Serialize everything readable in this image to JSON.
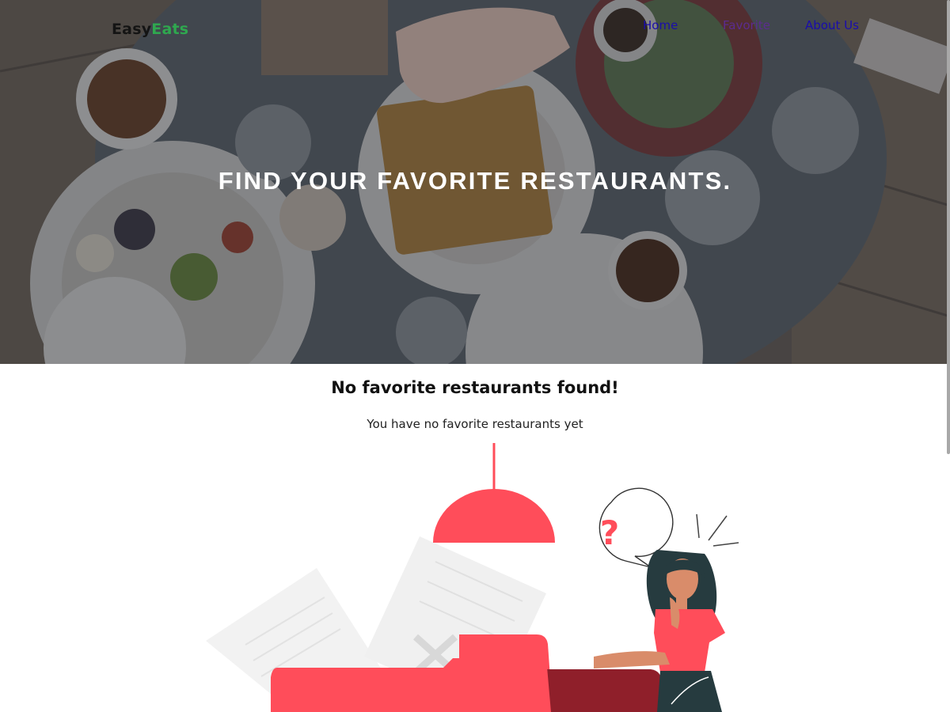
{
  "navbar": {
    "brand_part1": "Easy",
    "brand_part2": "Eats",
    "links": [
      {
        "label": "Home"
      },
      {
        "label": "Favorite"
      },
      {
        "label": "About Us"
      }
    ]
  },
  "hero": {
    "title": "FIND YOUR FAVORITE RESTAURANTS."
  },
  "empty_state": {
    "title": "No favorite restaurants found!",
    "subtitle": "You have no favorite restaurants yet"
  },
  "colors": {
    "brand_green": "#2fa84f",
    "accent_red": "#ff4d5a",
    "link_blue": "#1a0dab",
    "link_visited": "#5b2c8f"
  }
}
